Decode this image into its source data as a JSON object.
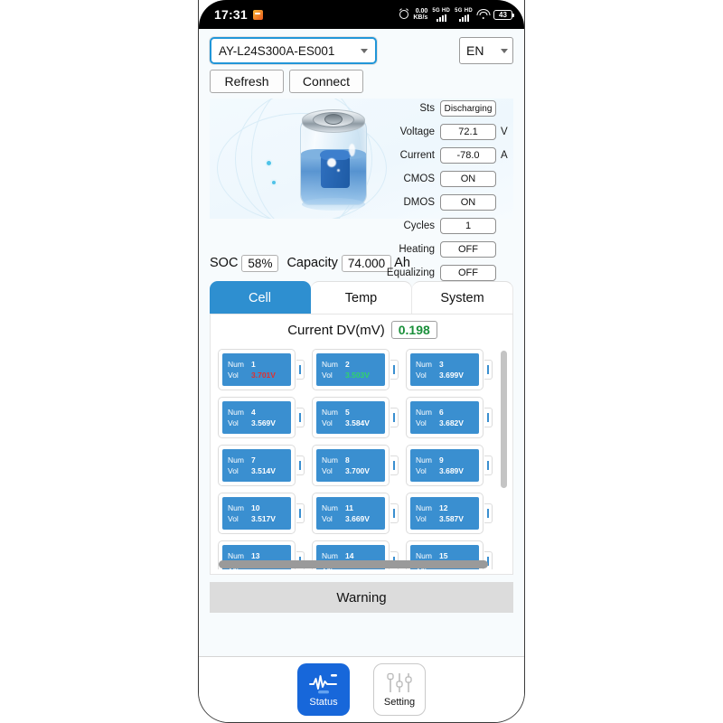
{
  "statusbar": {
    "time": "17:31",
    "app_icon": "app-icon",
    "alarm_icon": "alarm-icon",
    "net_speed_value": "0.00",
    "net_speed_unit": "KB/s",
    "sim1_label": "5G HD",
    "sim2_label": "5G HD",
    "wifi_icon": "wifi-icon",
    "battery_percent": "43"
  },
  "toolbar": {
    "device": {
      "value": "AY-L24S300A-ES001",
      "dropdown_icon": "chevron-down-icon"
    },
    "language": {
      "value": "EN",
      "dropdown_icon": "chevron-down-icon"
    },
    "refresh_label": "Refresh",
    "connect_label": "Connect"
  },
  "hero": {
    "battery_icon": "battery-cell-illustration",
    "soc_label": "SOC",
    "soc_value": "58%",
    "capacity_label": "Capacity",
    "capacity_value": "74.000",
    "capacity_unit": "Ah"
  },
  "status": {
    "rows": [
      {
        "label": "Sts",
        "value": "Discharging",
        "unit": ""
      },
      {
        "label": "Voltage",
        "value": "72.1",
        "unit": "V"
      },
      {
        "label": "Current",
        "value": "-78.0",
        "unit": "A"
      },
      {
        "label": "CMOS",
        "value": "ON",
        "unit": ""
      },
      {
        "label": "DMOS",
        "value": "ON",
        "unit": ""
      },
      {
        "label": "Cycles",
        "value": "1",
        "unit": ""
      },
      {
        "label": "Heating",
        "value": "OFF",
        "unit": ""
      },
      {
        "label": "Equalizing",
        "value": "OFF",
        "unit": ""
      }
    ]
  },
  "tabs": [
    {
      "label": "Cell",
      "active": true
    },
    {
      "label": "Temp",
      "active": false
    },
    {
      "label": "System",
      "active": false
    }
  ],
  "cellpanel": {
    "dv_label": "Current DV(mV)",
    "dv_value": "0.198",
    "dv_color": "#1a8f3a",
    "num_label": "Num",
    "vol_label": "Vol",
    "highlight_high_color": "#e03030",
    "highlight_low_color": "#2fd46a",
    "default_color": "#ffffff",
    "cells": [
      {
        "num": "1",
        "vol": "3.701V",
        "state": "high"
      },
      {
        "num": "2",
        "vol": "3.503V",
        "state": "low"
      },
      {
        "num": "3",
        "vol": "3.699V",
        "state": "normal"
      },
      {
        "num": "4",
        "vol": "3.569V",
        "state": "normal"
      },
      {
        "num": "5",
        "vol": "3.584V",
        "state": "normal"
      },
      {
        "num": "6",
        "vol": "3.682V",
        "state": "normal"
      },
      {
        "num": "7",
        "vol": "3.514V",
        "state": "normal"
      },
      {
        "num": "8",
        "vol": "3.700V",
        "state": "normal"
      },
      {
        "num": "9",
        "vol": "3.689V",
        "state": "normal"
      },
      {
        "num": "10",
        "vol": "3.517V",
        "state": "normal"
      },
      {
        "num": "11",
        "vol": "3.669V",
        "state": "normal"
      },
      {
        "num": "12",
        "vol": "3.587V",
        "state": "normal"
      },
      {
        "num": "13",
        "vol": "",
        "state": "normal"
      },
      {
        "num": "14",
        "vol": "",
        "state": "normal"
      },
      {
        "num": "15",
        "vol": "",
        "state": "normal"
      }
    ]
  },
  "warning": {
    "label": "Warning"
  },
  "bottomnav": {
    "items": [
      {
        "label": "Status",
        "icon": "waveform-icon",
        "active": true
      },
      {
        "label": "Setting",
        "icon": "sliders-icon",
        "active": false
      }
    ]
  }
}
